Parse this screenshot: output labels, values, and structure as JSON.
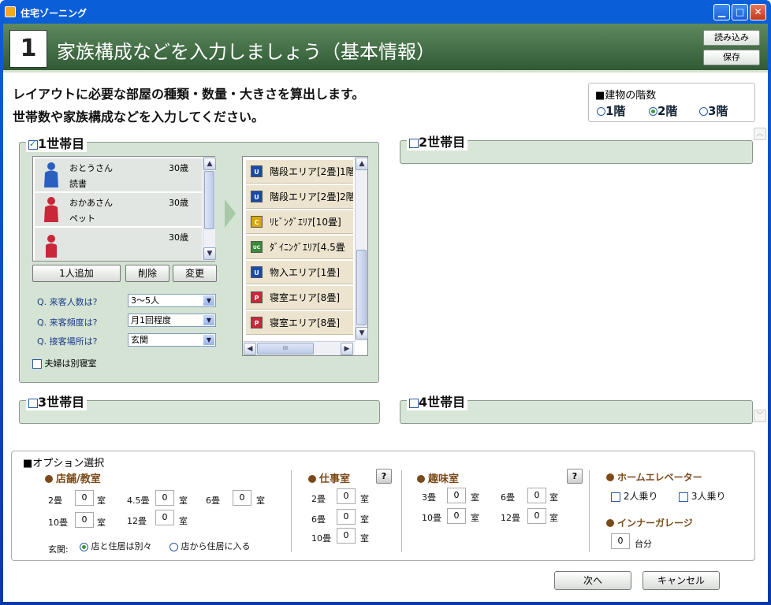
{
  "window": {
    "title": "住宅ゾーニング",
    "min": "▁",
    "max": "□",
    "close": "✕"
  },
  "header": {
    "step": "1",
    "title": "家族構成などを入力しましょう（基本情報）",
    "load": "読み込み",
    "save": "保存"
  },
  "intro": {
    "line1": "レイアウトに必要な部屋の種類・数量・大きさを算出します。",
    "line2": "世帯数や家族構成などを入力してください。"
  },
  "floors": {
    "title": "■建物の階数",
    "options": [
      "1階",
      "2階",
      "3階"
    ],
    "selected": "2階"
  },
  "household1": {
    "title": "1世帯目",
    "checked": true,
    "members": [
      {
        "name": "おとうさん",
        "age": "30歳",
        "hobby": "読書",
        "color": "#2a5fc0"
      },
      {
        "name": "おかあさん",
        "age": "30歳",
        "hobby": "ペット",
        "color": "#c8283a"
      },
      {
        "name": "",
        "age": "30歳",
        "hobby": "",
        "color": "#c8283a"
      }
    ],
    "buttons": {
      "add": "1人追加",
      "delete": "削除",
      "change": "変更"
    },
    "questions": [
      {
        "q": "Q. 来客人数は?",
        "a": "3～5人"
      },
      {
        "q": "Q. 来客頻度は?",
        "a": "月1回程度"
      },
      {
        "q": "Q. 接客場所は?",
        "a": "玄関"
      }
    ],
    "separate": "夫婦は別寝室",
    "areas": [
      {
        "tag": "U",
        "label": "階段エリア[2畳]1階",
        "color": "#1a4aa8"
      },
      {
        "tag": "U",
        "label": "階段エリア[2畳]2階",
        "color": "#1a4aa8"
      },
      {
        "tag": "C",
        "label": "ﾘﾋﾞﾝｸﾞｴﾘｱ[10畳]",
        "color": "#d8a800"
      },
      {
        "tag": "UC",
        "label": "ﾀﾞｲﾆﾝｸﾞｴﾘｱ[4.5畳",
        "color": "#3a8a3a"
      },
      {
        "tag": "U",
        "label": "物入エリア[1畳]",
        "color": "#1a4aa8"
      },
      {
        "tag": "P",
        "label": "寝室エリア[8畳]",
        "color": "#c8283a"
      },
      {
        "tag": "P",
        "label": "寝室エリア[8畳]",
        "color": "#c8283a"
      }
    ],
    "hscroll": "III"
  },
  "household2": {
    "title": "2世帯目",
    "checked": false
  },
  "household3": {
    "title": "3世帯目",
    "checked": false
  },
  "household4": {
    "title": "4世帯目",
    "checked": false
  },
  "options": {
    "title": "■オプション選択",
    "shop": {
      "title": "店舗/教室",
      "rows": [
        [
          {
            "size": "2畳",
            "val": "0"
          },
          {
            "size": "4.5畳",
            "val": "0"
          },
          {
            "size": "6畳",
            "val": "0"
          }
        ],
        [
          {
            "size": "10畳",
            "val": "0"
          },
          {
            "size": "12畳",
            "val": "0"
          }
        ]
      ],
      "unit": "室",
      "entrance": "玄関:",
      "entr1": "店と住居は別々",
      "entr2": "店から住居に入る"
    },
    "work": {
      "title": "仕事室",
      "rows": [
        {
          "size": "2畳",
          "val": "0"
        },
        {
          "size": "6畳",
          "val": "0"
        },
        {
          "size": "10畳",
          "val": "0"
        }
      ]
    },
    "hobby": {
      "title": "趣味室",
      "rows": [
        [
          {
            "size": "3畳",
            "val": "0"
          },
          {
            "size": "6畳",
            "val": "0"
          }
        ],
        [
          {
            "size": "10畳",
            "val": "0"
          },
          {
            "size": "12畳",
            "val": "0"
          }
        ]
      ]
    },
    "elevator": {
      "title": "ホームエレベーター",
      "o1": "2人乗り",
      "o2": "3人乗り"
    },
    "garage": {
      "title": "インナーガレージ",
      "val": "0",
      "unit": "台分"
    },
    "help": "?"
  },
  "footer": {
    "next": "次へ",
    "cancel": "キャンセル"
  }
}
